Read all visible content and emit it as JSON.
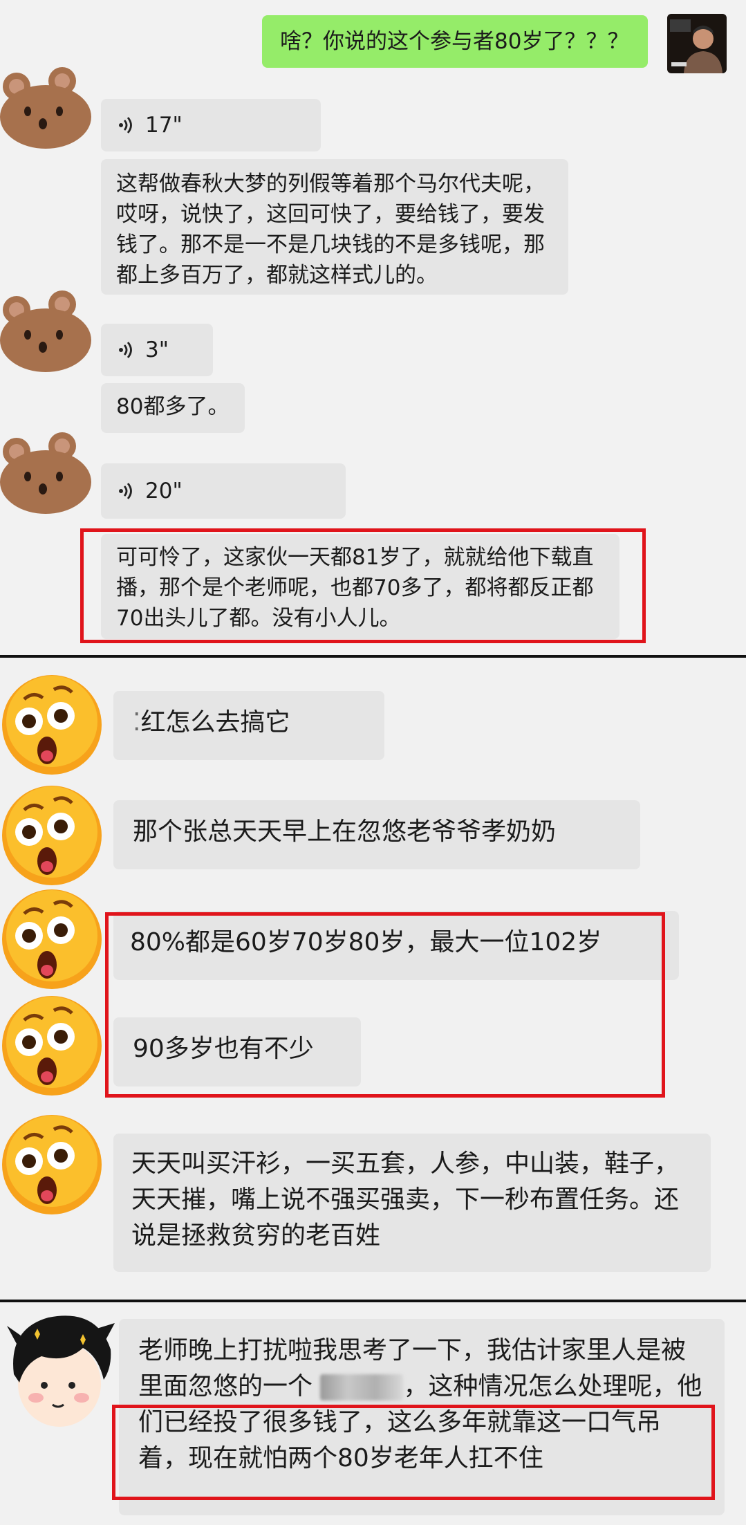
{
  "panel1": {
    "outgoing_text": "啥？你说的这个参与者80岁了？？？",
    "voice1_duration": "17\"",
    "text1": "这帮做春秋大梦的列假等着那个马尔代夫呢，哎呀，说快了，这回可快了，要给钱了，要发钱了。那不是一不是几块钱的不是多钱呢，那都上多百万了，都就这样式儿的。",
    "voice2_duration": "3\"",
    "text2": "80都多了。",
    "voice3_duration": "20\"",
    "text3": "可可怜了，这家伙一天都81岁了，就就给他下载直播，那个是个老师呢，也都70多了，都将都反正都70出头儿了都。没有小人儿。"
  },
  "panel2": {
    "msg1_prefix": "⁚",
    "msg1": "红怎么去搞它",
    "msg2": "那个张总天天早上在忽悠老爷爷孝奶奶",
    "msg3": "80%都是60岁70岁80岁，最大一位102岁",
    "msg4": "90多岁也有不少",
    "msg5": "天天叫买汗衫，一买五套，人参，中山装，鞋子，天天摧，嘴上说不强买强卖，下一秒布置任务。还说是拯救贫穷的老百姓"
  },
  "panel3": {
    "msg_part1": "老师晚上打扰啦我思考了一下，我估计家里人是被里面忽悠的一个",
    "msg_part2": "，这种情况怎么处理呢，他们已经投了很多钱了，这么多年就靠这一口气吊着，现在就怕两个80岁老年人扛不住"
  },
  "icons": {
    "voice": "voice-wave-icon",
    "bear": "bear-avatar",
    "emoji": "shocked-emoji-avatar",
    "boy": "cartoon-boy-avatar",
    "person": "user-photo-avatar"
  },
  "colors": {
    "outgoing_bubble": "#95ec69",
    "incoming_bubble": "#e5e5e5",
    "highlight_box": "#e0141b"
  }
}
